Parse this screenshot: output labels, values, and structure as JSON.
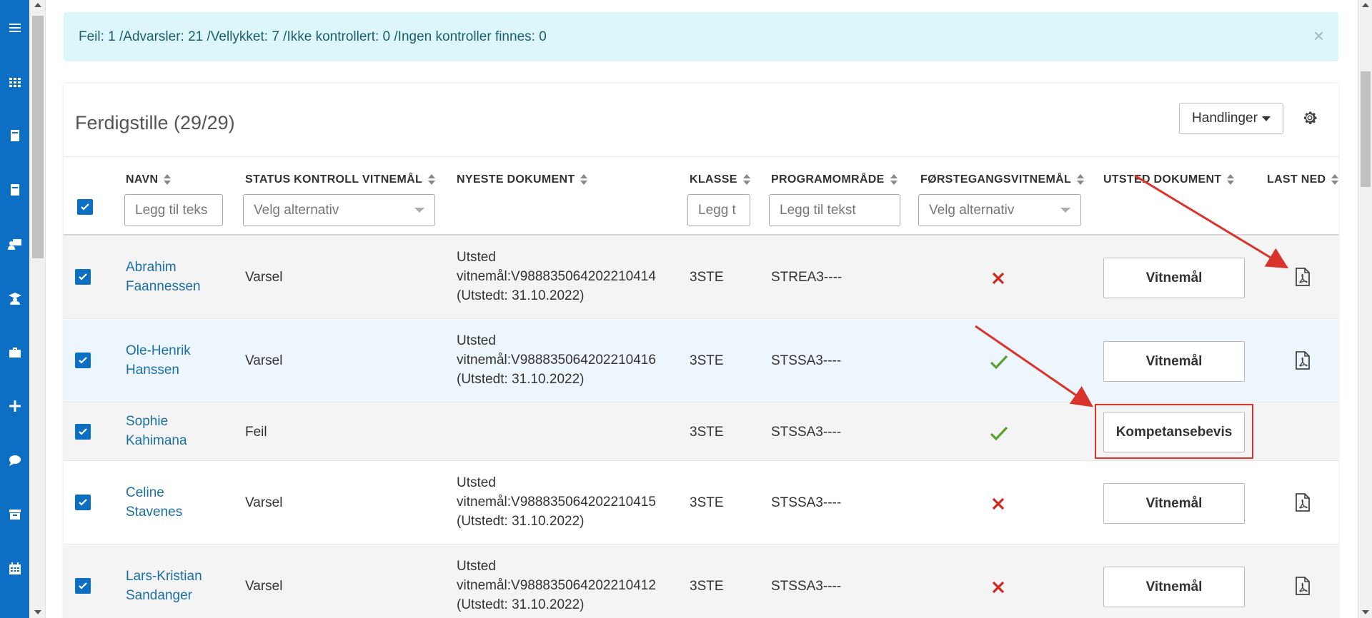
{
  "alert": {
    "message": "Feil: 1 /Advarsler: 21 /Vellykket: 7 /Ikke kontrollert: 0 /Ingen kontroller finnes: 0",
    "close_glyph": "×"
  },
  "sidebar": {
    "items": [
      {
        "icon": "menu-icon"
      },
      {
        "icon": "apps-grid-icon"
      },
      {
        "icon": "book-icon"
      },
      {
        "icon": "book-alt-icon"
      },
      {
        "icon": "teacher-icon"
      },
      {
        "icon": "graduation-icon"
      },
      {
        "icon": "briefcase-icon"
      },
      {
        "icon": "plus-icon"
      },
      {
        "icon": "chat-icon"
      },
      {
        "icon": "archive-icon"
      },
      {
        "icon": "calendar-icon"
      }
    ]
  },
  "card": {
    "title": "Ferdigstille (29/29)",
    "actions_label": "Handlinger"
  },
  "table": {
    "columns": {
      "name": "NAVN",
      "status": "STATUS KONTROLL VITNEMÅL",
      "document": "NYESTE DOKUMENT",
      "class": "KLASSE",
      "program": "PROGRAMOMRÅDE",
      "first": "FØRSTEGANGSVITNEMÅL",
      "issue": "UTSTED DOKUMENT",
      "download": "LAST NED"
    },
    "filters": {
      "name_placeholder": "Legg til teks",
      "status_placeholder": "Velg alternativ",
      "class_placeholder": "Legg t",
      "program_placeholder": "Legg til tekst",
      "first_placeholder": "Velg alternativ"
    },
    "rows": [
      {
        "first_name": "Abrahim",
        "last_name": "Faannessen",
        "status": "Varsel",
        "doc_line1": "Utsted",
        "doc_line2": "vitnemål:V988835064202210414",
        "doc_line3": "(Utstedt: 31.10.2022)",
        "class": "3STE",
        "program": "STREA3----",
        "first_time": false,
        "button": "Vitnemål",
        "has_pdf": true
      },
      {
        "first_name": "Ole-Henrik",
        "last_name": "Hanssen",
        "status": "Varsel",
        "doc_line1": "Utsted",
        "doc_line2": "vitnemål:V988835064202210416",
        "doc_line3": "(Utstedt: 31.10.2022)",
        "class": "3STE",
        "program": "STSSA3----",
        "first_time": true,
        "button": "Vitnemål",
        "has_pdf": true
      },
      {
        "first_name": "Sophie",
        "last_name": "Kahimana",
        "status": "Feil",
        "doc_line1": "",
        "doc_line2": "",
        "doc_line3": "",
        "class": "3STE",
        "program": "STSSA3----",
        "first_time": true,
        "button": "Kompetansebevis",
        "has_pdf": false
      },
      {
        "first_name": "Celine",
        "last_name": "Stavenes",
        "status": "Varsel",
        "doc_line1": "Utsted",
        "doc_line2": "vitnemål:V988835064202210415",
        "doc_line3": "(Utstedt: 31.10.2022)",
        "class": "3STE",
        "program": "STSSA3----",
        "first_time": false,
        "button": "Vitnemål",
        "has_pdf": true
      },
      {
        "first_name": "Lars-Kristian",
        "last_name": "Sandanger",
        "status": "Varsel",
        "doc_line1": "Utsted",
        "doc_line2": "vitnemål:V988835064202210412",
        "doc_line3": "(Utstedt: 31.10.2022)",
        "class": "3STE",
        "program": "STSSA3----",
        "first_time": false,
        "button": "Vitnemål",
        "has_pdf": true
      }
    ]
  },
  "colors": {
    "sidebar": "#0d6fc4",
    "alert_bg": "#dcf6fc",
    "link": "#1a6fa8",
    "error_x": "#d0281e",
    "success_check": "#5aa02c",
    "annotation": "#d9342b"
  }
}
